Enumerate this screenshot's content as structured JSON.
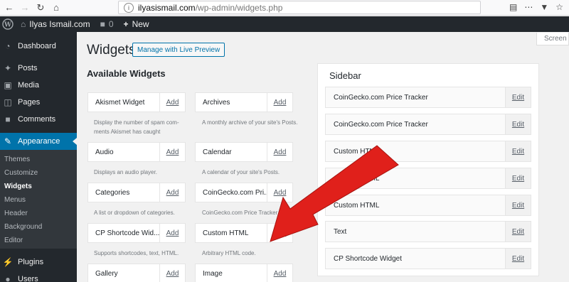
{
  "browser": {
    "url_host": "ilyasismail.com",
    "url_path": "/wp-admin/widgets.php"
  },
  "adminbar": {
    "site_name": "Ilyas Ismail.com",
    "comments_count": "0",
    "new_label": "New"
  },
  "menu": {
    "dashboard": "Dashboard",
    "posts": "Posts",
    "media": "Media",
    "pages": "Pages",
    "comments": "Comments",
    "appearance": "Appearance",
    "submenu": [
      "Themes",
      "Customize",
      "Widgets",
      "Menus",
      "Header",
      "Background",
      "Editor"
    ],
    "plugins": "Plugins",
    "users": "Users"
  },
  "screen_options": "Screen O",
  "page": {
    "title": "Widgets",
    "live_preview": "Manage with Live Preview",
    "available_title": "Available Widgets"
  },
  "widgets": [
    {
      "title": "Akismet Widget",
      "add": "Add",
      "desc": "Display the number of spam com-ments Akismet has caught"
    },
    {
      "title": "Archives",
      "add": "Add",
      "desc": "A monthly archive of your site's Posts."
    },
    {
      "title": "Audio",
      "add": "Add",
      "desc": "Displays an audio player."
    },
    {
      "title": "Calendar",
      "add": "Add",
      "desc": "A calendar of your site's Posts."
    },
    {
      "title": "Categories",
      "add": "Add",
      "desc": "A list or dropdown of categories."
    },
    {
      "title": "CoinGecko.com Pri...",
      "add": "Add",
      "desc": "CoinGecko.com Price Tracker"
    },
    {
      "title": "CP Shortcode Wid...",
      "add": "Add",
      "desc": "Supports shortcodes, text, HTML."
    },
    {
      "title": "Custom HTML",
      "add": "Add",
      "desc": "Arbitrary HTML code."
    },
    {
      "title": "Gallery",
      "add": "Add",
      "desc": ""
    },
    {
      "title": "Image",
      "add": "Add",
      "desc": ""
    }
  ],
  "sidebar": {
    "title": "Sidebar",
    "widgets": [
      {
        "title": "CoinGecko.com Price Tracker",
        "edit": "Edit"
      },
      {
        "title": "CoinGecko.com Price Tracker",
        "edit": "Edit"
      },
      {
        "title": "Custom HTML",
        "edit": "Edit"
      },
      {
        "title": "Custom HTML",
        "edit": "Edit"
      },
      {
        "title": "Custom HTML",
        "edit": "Edit"
      },
      {
        "title": "Text",
        "edit": "Edit"
      },
      {
        "title": "CP Shortcode Widget",
        "edit": "Edit"
      }
    ]
  },
  "colors": {
    "accent": "#0073aa",
    "admin_dark": "#23282d",
    "arrow_red": "#e0201b"
  }
}
